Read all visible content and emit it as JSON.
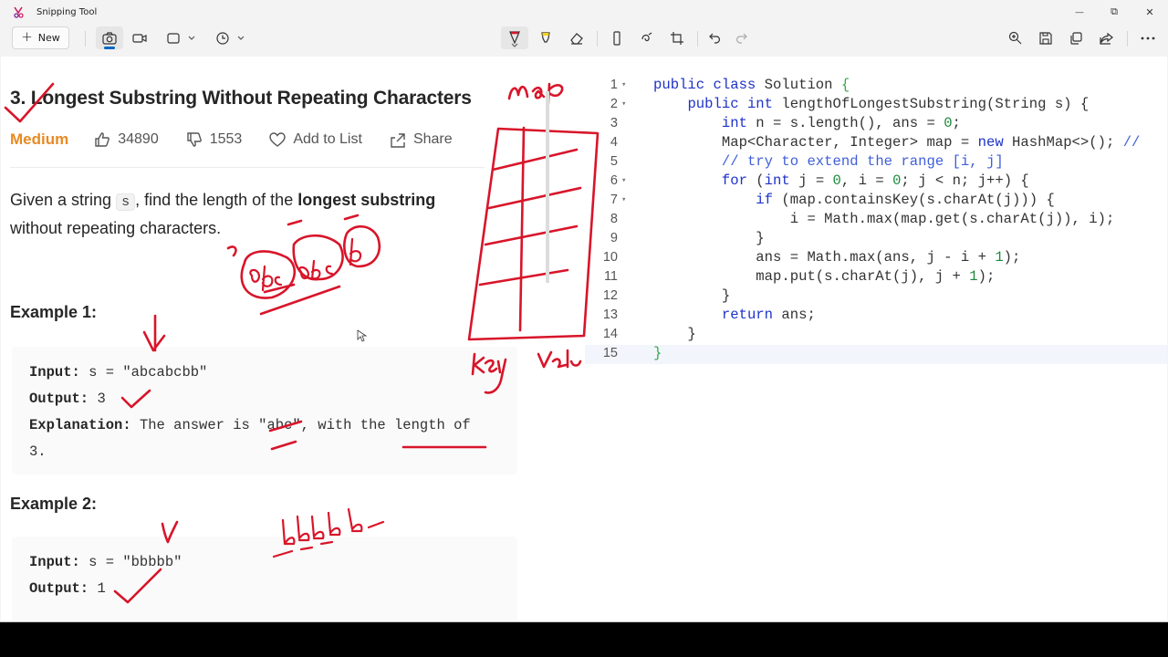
{
  "window": {
    "title": "Snipping Tool",
    "controls": {
      "minimize": "—",
      "restore": "⧉",
      "close": "✕"
    }
  },
  "toolbar": {
    "new_label": "New",
    "new_plus": "+",
    "accent_color": "#0067c0",
    "highlighter_color": "#f2d21b",
    "pen_color": "#d8152a"
  },
  "problem": {
    "title": "3. Longest Substring Without Repeating Characters",
    "difficulty": "Medium",
    "likes": "34890",
    "dislikes": "1553",
    "add_to_list": "Add to List",
    "share": "Share",
    "desc_before": "Given a string ",
    "desc_code": "s",
    "desc_middle": ", find the length of the ",
    "desc_bold": "longest substring",
    "desc_after": "without repeating characters.",
    "example1_title": "Example 1:",
    "example1_input_label": "Input:",
    "example1_input_value": "s = \"abcabcbb\"",
    "example1_output_label": "Output:",
    "example1_output_value": "3",
    "example1_expl_label": "Explanation:",
    "example1_expl_value": "The answer is \"abc\", with the length of",
    "example1_expl_cont": "3.",
    "example2_title": "Example 2:",
    "example2_input_label": "Input:",
    "example2_input_value": "s = \"bbbbb\"",
    "example2_output_label": "Output:",
    "example2_output_value": "1"
  },
  "editor": {
    "line_numbers": [
      "1",
      "2",
      "3",
      "4",
      "5",
      "6",
      "7",
      "8",
      "9",
      "10",
      "11",
      "12",
      "13",
      "14",
      "15"
    ],
    "fold_marker": "▾",
    "lines": [
      "public class Solution {",
      "    public int lengthOfLongestSubstring(String s) {",
      "        int n = s.length(), ans = 0;",
      "        Map<Character, Integer> map = new HashMap<>(); //",
      "        // try to extend the range [i, j]",
      "        for (int j = 0, i = 0; j < n; j++) {",
      "            if (map.containsKey(s.charAt(j))) {",
      "                i = Math.max(map.get(s.charAt(j)), i);",
      "            }",
      "            ans = Math.max(ans, j - i + 1);",
      "            map.put(s.charAt(j), j + 1);",
      "        }",
      "        return ans;",
      "    }",
      "}"
    ]
  }
}
